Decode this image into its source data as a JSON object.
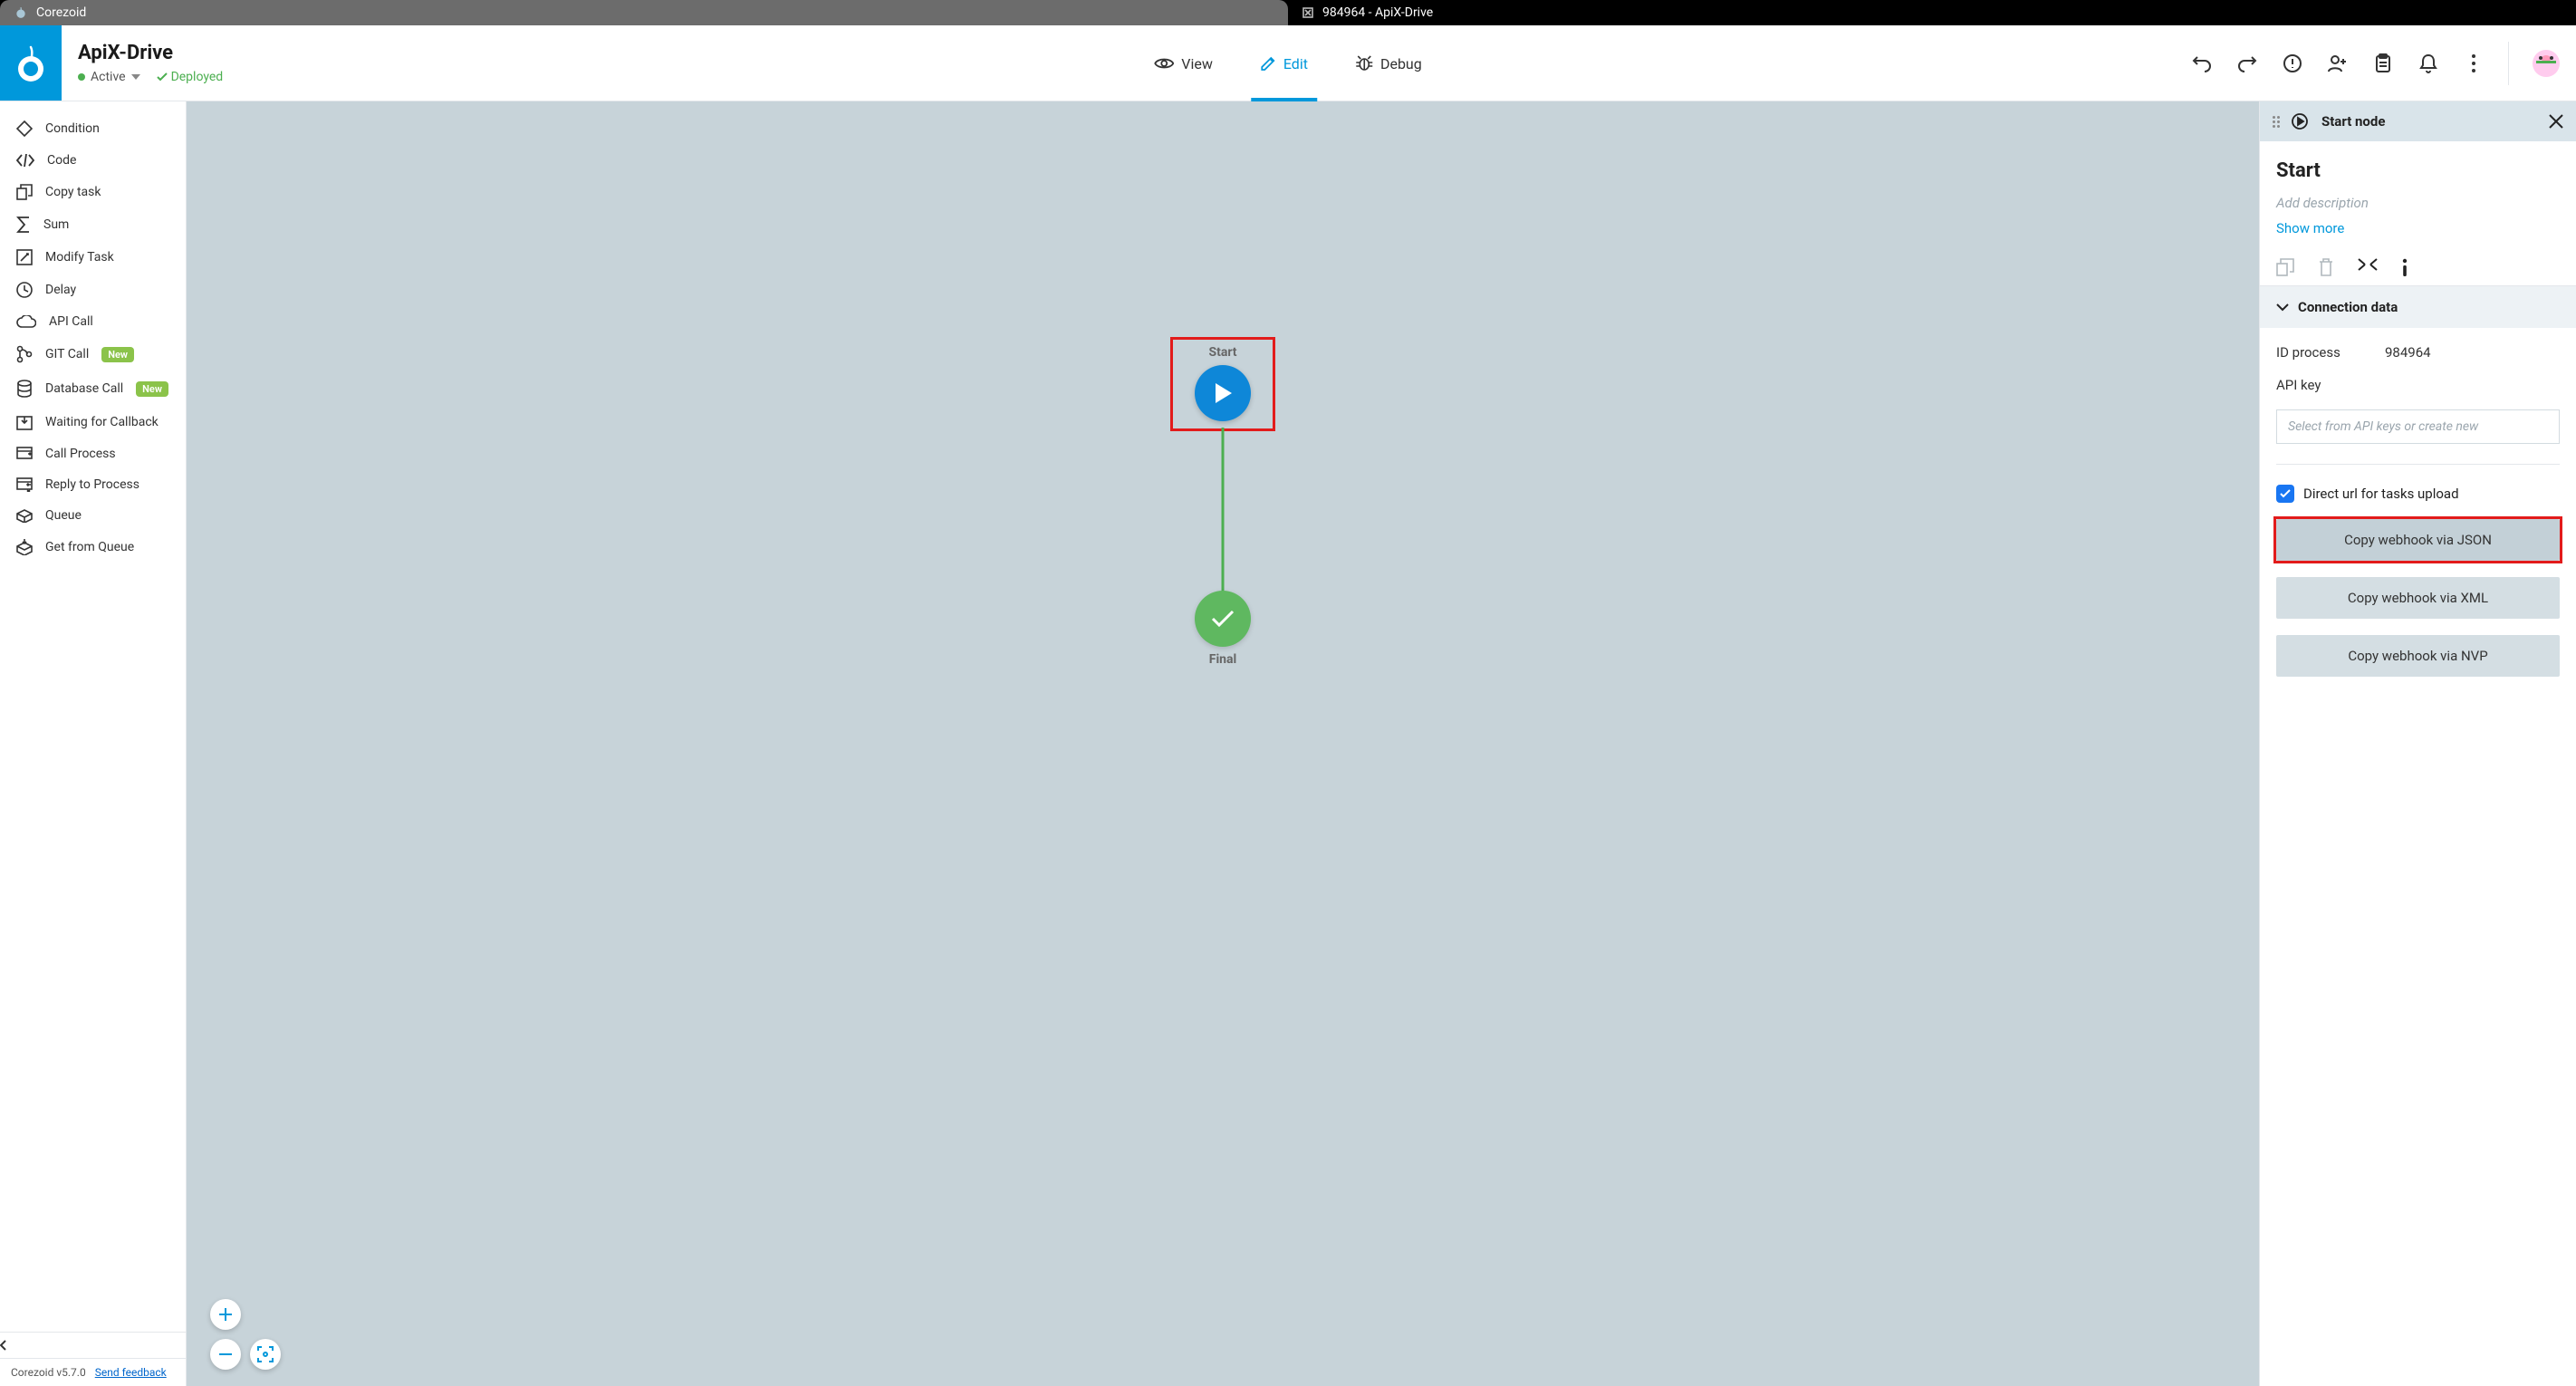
{
  "tabs": {
    "tab1": "Corezoid",
    "tab2": "984964 - ApiX-Drive"
  },
  "header": {
    "title": "ApiX-Drive",
    "status_active": "Active",
    "status_deployed": "Deployed"
  },
  "modes": {
    "view": "View",
    "edit": "Edit",
    "debug": "Debug"
  },
  "palette": {
    "items": [
      {
        "label": "Condition"
      },
      {
        "label": "Code"
      },
      {
        "label": "Copy task"
      },
      {
        "label": "Sum"
      },
      {
        "label": "Modify Task"
      },
      {
        "label": "Delay"
      },
      {
        "label": "API Call"
      },
      {
        "label": "GIT Call",
        "badge": "New"
      },
      {
        "label": "Database Call",
        "badge": "New"
      },
      {
        "label": "Waiting for Callback"
      },
      {
        "label": "Call Process"
      },
      {
        "label": "Reply to Process"
      },
      {
        "label": "Queue"
      },
      {
        "label": "Get from Queue"
      }
    ],
    "version": "Corezoid v5.7.0",
    "feedback": "Send feedback"
  },
  "canvas": {
    "start_label": "Start",
    "final_label": "Final"
  },
  "right_panel": {
    "header": "Start node",
    "title": "Start",
    "desc_placeholder": "Add description",
    "show_more": "Show more",
    "section_title": "Connection data",
    "id_label": "ID process",
    "id_value": "984964",
    "api_key_label": "API key",
    "api_key_placeholder": "Select from API keys or create new",
    "direct_url": "Direct url for tasks upload",
    "copy_json": "Copy webhook via JSON",
    "copy_xml": "Copy webhook via XML",
    "copy_nvp": "Copy webhook via NVP"
  }
}
